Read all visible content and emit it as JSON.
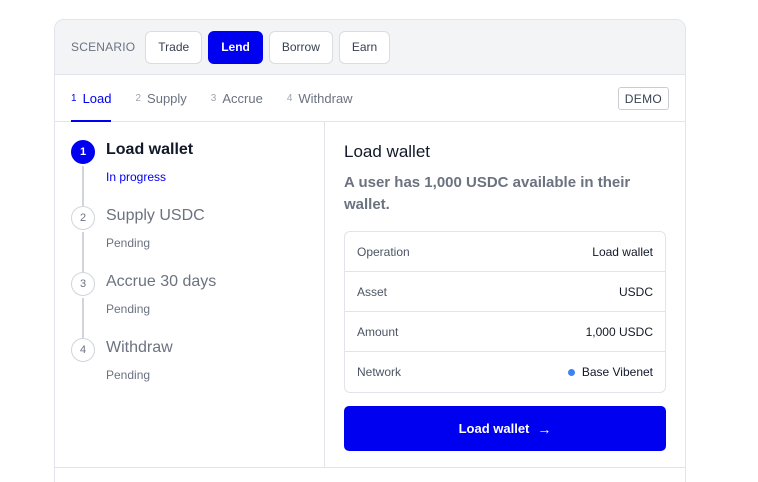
{
  "scenario": {
    "label": "SCENARIO",
    "options": [
      {
        "label": "Trade",
        "active": false
      },
      {
        "label": "Lend",
        "active": true
      },
      {
        "label": "Borrow",
        "active": false
      },
      {
        "label": "Earn",
        "active": false
      }
    ]
  },
  "tabs": [
    {
      "num": "1",
      "label": "Load",
      "active": true
    },
    {
      "num": "2",
      "label": "Supply",
      "active": false
    },
    {
      "num": "3",
      "label": "Accrue",
      "active": false
    },
    {
      "num": "4",
      "label": "Withdraw",
      "active": false
    }
  ],
  "demo_badge": "DEMO",
  "steps": [
    {
      "num": "1",
      "title": "Load wallet",
      "status": "In progress",
      "current": true
    },
    {
      "num": "2",
      "title": "Supply USDC",
      "status": "Pending",
      "current": false
    },
    {
      "num": "3",
      "title": "Accrue 30 days",
      "status": "Pending",
      "current": false
    },
    {
      "num": "4",
      "title": "Withdraw",
      "status": "Pending",
      "current": false
    }
  ],
  "detail": {
    "title": "Load wallet",
    "description": "A user has 1,000 USDC available in their wallet.",
    "rows": [
      {
        "key": "Operation",
        "value": "Load wallet"
      },
      {
        "key": "Asset",
        "value": "USDC"
      },
      {
        "key": "Amount",
        "value": "1,000 USDC"
      },
      {
        "key": "Network",
        "value": "Base Vibenet"
      }
    ],
    "button_label": "Load wallet",
    "button_arrow": "→"
  },
  "colors": {
    "accent": "#0000f0",
    "network_dot": "#3b82f6"
  }
}
